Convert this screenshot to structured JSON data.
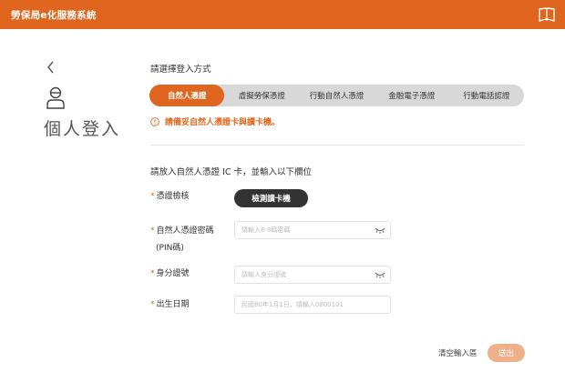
{
  "header": {
    "title": "勞保局e化服務系統",
    "icon": "book-icon"
  },
  "page": {
    "title": "個人登入"
  },
  "login": {
    "section_label": "請選擇登入方式",
    "tabs": [
      {
        "label": "自然人憑證",
        "active": true
      },
      {
        "label": "虛擬勞保憑證",
        "active": false
      },
      {
        "label": "行動自然人憑證",
        "active": false
      },
      {
        "label": "金融電子憑證",
        "active": false
      },
      {
        "label": "行動電話認證",
        "active": false
      }
    ],
    "notice": "請備妥自然人憑證卡與讀卡機。"
  },
  "form": {
    "instruction": "請放入自然人憑證 IC 卡，並輸入以下欄位",
    "required_mark": "*",
    "cert_check": {
      "label": "憑證檢核",
      "button": "檢測讀卡機"
    },
    "pin": {
      "label": "自然人憑證密碼",
      "sub_label": "(PIN碼)",
      "placeholder": "請輸入6-8碼密碼"
    },
    "id_number": {
      "label": "身分證號",
      "placeholder": "請輸入身分證號"
    },
    "birth_date": {
      "label": "出生日期",
      "placeholder": "民國80年1月1日，請輸入0800101"
    }
  },
  "actions": {
    "clear": "清空輸入區",
    "submit": "送出"
  },
  "colors": {
    "accent": "#e0661f",
    "submit_disabled": "#f0b08c",
    "tab_track": "#d8d8d8",
    "dark_button": "#333333"
  }
}
